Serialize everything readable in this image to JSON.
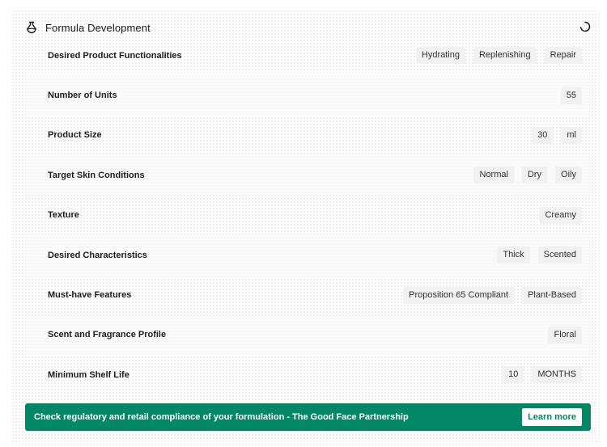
{
  "header": {
    "title": "Formula Development",
    "icon": "flask-icon",
    "status_icon": "loading-spinner-icon"
  },
  "rows": [
    {
      "label": "Desired Product Functionalities",
      "values": [
        "Hydrating",
        "Replenishing",
        "Repair"
      ]
    },
    {
      "label": "Number of Units",
      "values": [
        "55"
      ]
    },
    {
      "label": "Product Size",
      "values": [
        "30",
        "ml"
      ]
    },
    {
      "label": "Target Skin Conditions",
      "values": [
        "Normal",
        "Dry",
        "Oily"
      ]
    },
    {
      "label": "Texture",
      "values": [
        "Creamy"
      ]
    },
    {
      "label": "Desired Characteristics",
      "values": [
        "Thick",
        "Scented"
      ]
    },
    {
      "label": "Must-have Features",
      "values": [
        "Proposition 65 Compliant",
        "Plant-Based"
      ]
    },
    {
      "label": "Scent and Fragrance Profile",
      "values": [
        "Floral"
      ]
    },
    {
      "label": "Minimum Shelf Life",
      "values": [
        "10",
        "MONTHS"
      ]
    }
  ],
  "banner": {
    "text": "Check regulatory and retail compliance of your formulation - The Good Face Partnership",
    "button_label": "Learn more",
    "color": "#038766"
  }
}
